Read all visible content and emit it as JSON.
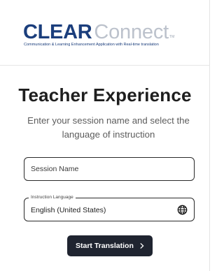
{
  "header": {
    "logo_primary": "CLEAR",
    "logo_secondary": "Connect",
    "logo_tm": "TM",
    "tagline": "Communication & Learning Enhancement Application with Real-time translation"
  },
  "main": {
    "title": "Teacher Experience",
    "subtitle": "Enter your session name and select the language of instruction",
    "session_field": {
      "placeholder": "Session Name",
      "value": ""
    },
    "language_field": {
      "label": "Instruction Language",
      "value": "English (United States)",
      "icon": "globe-icon"
    },
    "start_button": {
      "label": "Start Translation",
      "icon": "chevron-right-icon"
    }
  },
  "colors": {
    "brand_primary": "#1b3e7c",
    "brand_secondary": "#bcc2cc",
    "button_bg": "#1f2430",
    "title_text": "#1e1e1e",
    "subtitle_text": "#5c5c5c"
  }
}
